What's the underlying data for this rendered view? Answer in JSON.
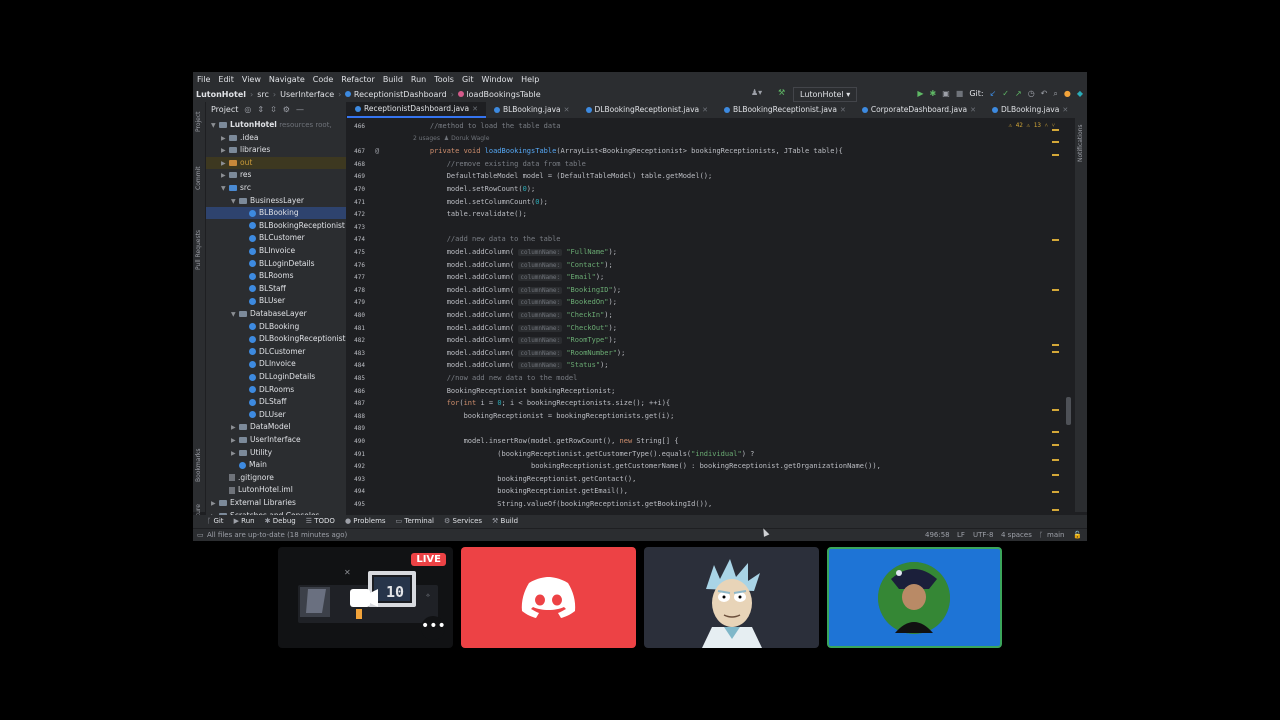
{
  "menu": [
    "File",
    "Edit",
    "View",
    "Navigate",
    "Code",
    "Refactor",
    "Build",
    "Run",
    "Tools",
    "Git",
    "Window",
    "Help"
  ],
  "breadcrumb": [
    "LutonHotel",
    "src",
    "UserInterface",
    "ReceptionistDashboard",
    "loadBookingsTable"
  ],
  "run_config": "LutonHotel",
  "git_label": "Git:",
  "project_panel": {
    "title": "Project",
    "root": "LutonHotel",
    "root_hint": "resources root,",
    "rows": [
      {
        "depth": 1,
        "label": ".idea",
        "icon": "folder"
      },
      {
        "depth": 1,
        "label": "libraries",
        "icon": "folder"
      },
      {
        "depth": 1,
        "label": "out",
        "icon": "folder-orange",
        "style": "out"
      },
      {
        "depth": 1,
        "label": "res",
        "icon": "folder"
      },
      {
        "depth": 1,
        "label": "src",
        "icon": "folder-blue",
        "open": true
      },
      {
        "depth": 2,
        "label": "BusinessLayer",
        "icon": "folder",
        "open": true
      },
      {
        "depth": 3,
        "label": "BLBooking",
        "icon": "class",
        "selected": true
      },
      {
        "depth": 3,
        "label": "BLBookingReceptionist",
        "icon": "class"
      },
      {
        "depth": 3,
        "label": "BLCustomer",
        "icon": "class"
      },
      {
        "depth": 3,
        "label": "BLInvoice",
        "icon": "class"
      },
      {
        "depth": 3,
        "label": "BLLoginDetails",
        "icon": "class"
      },
      {
        "depth": 3,
        "label": "BLRooms",
        "icon": "class"
      },
      {
        "depth": 3,
        "label": "BLStaff",
        "icon": "class"
      },
      {
        "depth": 3,
        "label": "BLUser",
        "icon": "class"
      },
      {
        "depth": 2,
        "label": "DatabaseLayer",
        "icon": "folder",
        "open": true
      },
      {
        "depth": 3,
        "label": "DLBooking",
        "icon": "class"
      },
      {
        "depth": 3,
        "label": "DLBookingReceptionist",
        "icon": "class"
      },
      {
        "depth": 3,
        "label": "DLCustomer",
        "icon": "class"
      },
      {
        "depth": 3,
        "label": "DLInvoice",
        "icon": "class"
      },
      {
        "depth": 3,
        "label": "DLLoginDetails",
        "icon": "class"
      },
      {
        "depth": 3,
        "label": "DLRooms",
        "icon": "class"
      },
      {
        "depth": 3,
        "label": "DLStaff",
        "icon": "class"
      },
      {
        "depth": 3,
        "label": "DLUser",
        "icon": "class"
      },
      {
        "depth": 2,
        "label": "DataModel",
        "icon": "folder"
      },
      {
        "depth": 2,
        "label": "UserInterface",
        "icon": "folder"
      },
      {
        "depth": 2,
        "label": "Utility",
        "icon": "folder"
      },
      {
        "depth": 2,
        "label": "Main",
        "icon": "class-main"
      },
      {
        "depth": 1,
        "label": ".gitignore",
        "icon": "file"
      },
      {
        "depth": 1,
        "label": "LutonHotel.iml",
        "icon": "file"
      },
      {
        "depth": 0,
        "label": "External Libraries",
        "icon": "folder"
      },
      {
        "depth": 0,
        "label": "Scratches and Consoles",
        "icon": "folder"
      }
    ]
  },
  "left_strip": [
    "Project",
    "Commit",
    "Pull Requests",
    "Bookmarks",
    "Structure"
  ],
  "right_strip": [
    "Notifications"
  ],
  "tabs": [
    {
      "label": "ReceptionistDashboard.java",
      "active": true
    },
    {
      "label": "BLBooking.java"
    },
    {
      "label": "DLBookingReceptionist.java"
    },
    {
      "label": "BLBookingReceptionist.java"
    },
    {
      "label": "CorporateDashboard.java"
    },
    {
      "label": "DLBooking.java"
    }
  ],
  "inspections": {
    "warnings": "42",
    "weak": "13"
  },
  "usages": {
    "count": "2 usages",
    "author": "Doruk Wagle"
  },
  "code_lines": [
    {
      "n": "466",
      "text": "    //method to load the table data",
      "cls": "comment"
    },
    {
      "n": "467",
      "text": "    private void loadBookingsTable(ArrayList<BookingReceptionist> bookingReceptionists, JTable table){",
      "cls": "sig"
    },
    {
      "n": "468",
      "text": "        //remove existing data from table",
      "cls": "comment"
    },
    {
      "n": "469",
      "text": "        DefaultTableModel model = (DefaultTableModel) table.getModel();"
    },
    {
      "n": "470",
      "text": "        model.setRowCount(0);"
    },
    {
      "n": "471",
      "text": "        model.setColumnCount(0);"
    },
    {
      "n": "472",
      "text": "        table.revalidate();"
    },
    {
      "n": "473",
      "text": ""
    },
    {
      "n": "474",
      "text": "        //add new data to the table",
      "cls": "comment"
    },
    {
      "n": "475",
      "col": "FullName"
    },
    {
      "n": "476",
      "col": "Contact"
    },
    {
      "n": "477",
      "col": "Email"
    },
    {
      "n": "478",
      "col": "BookingID"
    },
    {
      "n": "479",
      "col": "BookedOn"
    },
    {
      "n": "480",
      "col": "CheckIn"
    },
    {
      "n": "481",
      "col": "CheckOut"
    },
    {
      "n": "482",
      "col": "RoomType"
    },
    {
      "n": "483",
      "col": "RoomNumber"
    },
    {
      "n": "484",
      "col": "Status"
    },
    {
      "n": "485",
      "text": "        //now add new data to the model",
      "cls": "comment"
    },
    {
      "n": "486",
      "text": "        BookingReceptionist bookingReceptionist;"
    },
    {
      "n": "487",
      "text": "        for(int i = 0; i < bookingReceptionists.size(); ++i){"
    },
    {
      "n": "488",
      "text": "            bookingReceptionist = bookingReceptionists.get(i);"
    },
    {
      "n": "489",
      "text": ""
    },
    {
      "n": "490",
      "text": "            model.insertRow(model.getRowCount(), new String[] {"
    },
    {
      "n": "491",
      "text": "                    (bookingReceptionist.getCustomerType().equals(\"individual\") ?"
    },
    {
      "n": "492",
      "text": "                            bookingReceptionist.getCustomerName() : bookingReceptionist.getOrganizationName()),"
    },
    {
      "n": "493",
      "text": "                    bookingReceptionist.getContact(),"
    },
    {
      "n": "494",
      "text": "                    bookingReceptionist.getEmail(),"
    },
    {
      "n": "495",
      "text": "                    String.valueOf(bookingReceptionist.getBookingId()),"
    }
  ],
  "param_hint": "columnName:",
  "bottom_tools": [
    "Git",
    "Run",
    "Debug",
    "TODO",
    "Problems",
    "Terminal",
    "Services",
    "Build"
  ],
  "status": {
    "message": "All files are up-to-date (18 minutes ago)",
    "position": "496:58",
    "line_sep": "LF",
    "encoding": "UTF-8",
    "indent": "4 spaces",
    "branch": "main"
  },
  "call_tiles": {
    "live_badge": "LIVE",
    "more": "•••",
    "screen_number": "10",
    "colors": {
      "discord": "#ed4245",
      "rick_bg": "#2b2f3a",
      "self_bg": "#1e74d6",
      "self_border": "#3ba55c"
    }
  }
}
